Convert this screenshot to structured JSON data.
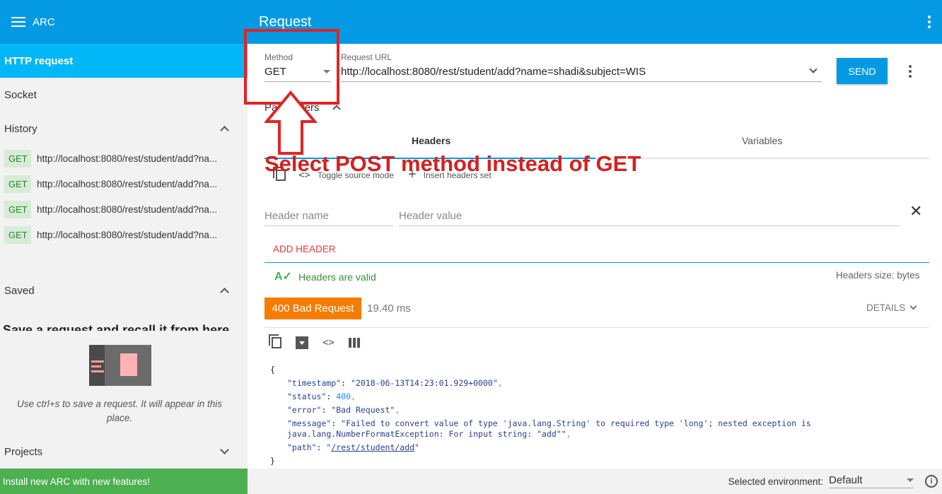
{
  "app": {
    "title": "ARC"
  },
  "sidebar": {
    "active_item": "HTTP request",
    "socket_label": "Socket",
    "history_label": "History",
    "history": [
      {
        "method": "GET",
        "url": "http://localhost:8080/rest/student/add?na..."
      },
      {
        "method": "GET",
        "url": "http://localhost:8080/rest/student/add?na..."
      },
      {
        "method": "GET",
        "url": "http://localhost:8080/rest/student/add?na..."
      },
      {
        "method": "GET",
        "url": "http://localhost:8080/rest/student/add?na..."
      }
    ],
    "saved_label": "Saved",
    "saved_heading": "Save a request and recall it from here",
    "saved_hint": "Use ctrl+s to save a request. It will appear in this place.",
    "projects_label": "Projects",
    "install_banner": "Install new ARC with new features!"
  },
  "request": {
    "title": "Request",
    "method_label": "Method",
    "method_value": "GET",
    "url_label": "Request URL",
    "url_value": "http://localhost:8080/rest/student/add?name=shadi&subject=WIS",
    "send_label": "SEND",
    "parameters_label": "Parameters",
    "tabs": [
      {
        "label": "Headers"
      },
      {
        "label": "Variables"
      }
    ],
    "toggle_source_label": "Toggle source mode",
    "insert_headers_label": "Insert headers set",
    "header_name_placeholder": "Header name",
    "header_value_placeholder": "Header value",
    "add_header_label": "ADD HEADER",
    "headers_valid": "Headers are valid",
    "headers_size": "Headers size: bytes"
  },
  "response": {
    "status": "400 Bad Request",
    "time": "19.40 ms",
    "details_label": "DETAILS",
    "body": {
      "timestamp": "\"2018-06-13T14:23:01.929+0000\"",
      "status": "400",
      "error": "\"Bad Request\"",
      "message_line1": "\"Failed to convert value of type 'java.lang.String' to required type 'long'; nested exception is",
      "message_line2": "java.lang.NumberFormatException: For input string: \"add\"\"",
      "path": "/rest/student/add"
    }
  },
  "footer": {
    "env_label": "Selected environment:",
    "env_value": "Default"
  },
  "annotation": {
    "text": "Select POST method instead of GET",
    "color": "#e02424"
  },
  "colors": {
    "accent": "#039ae3",
    "active": "#02b7f7",
    "error_status": "#f57c00",
    "install": "#4caf50"
  }
}
